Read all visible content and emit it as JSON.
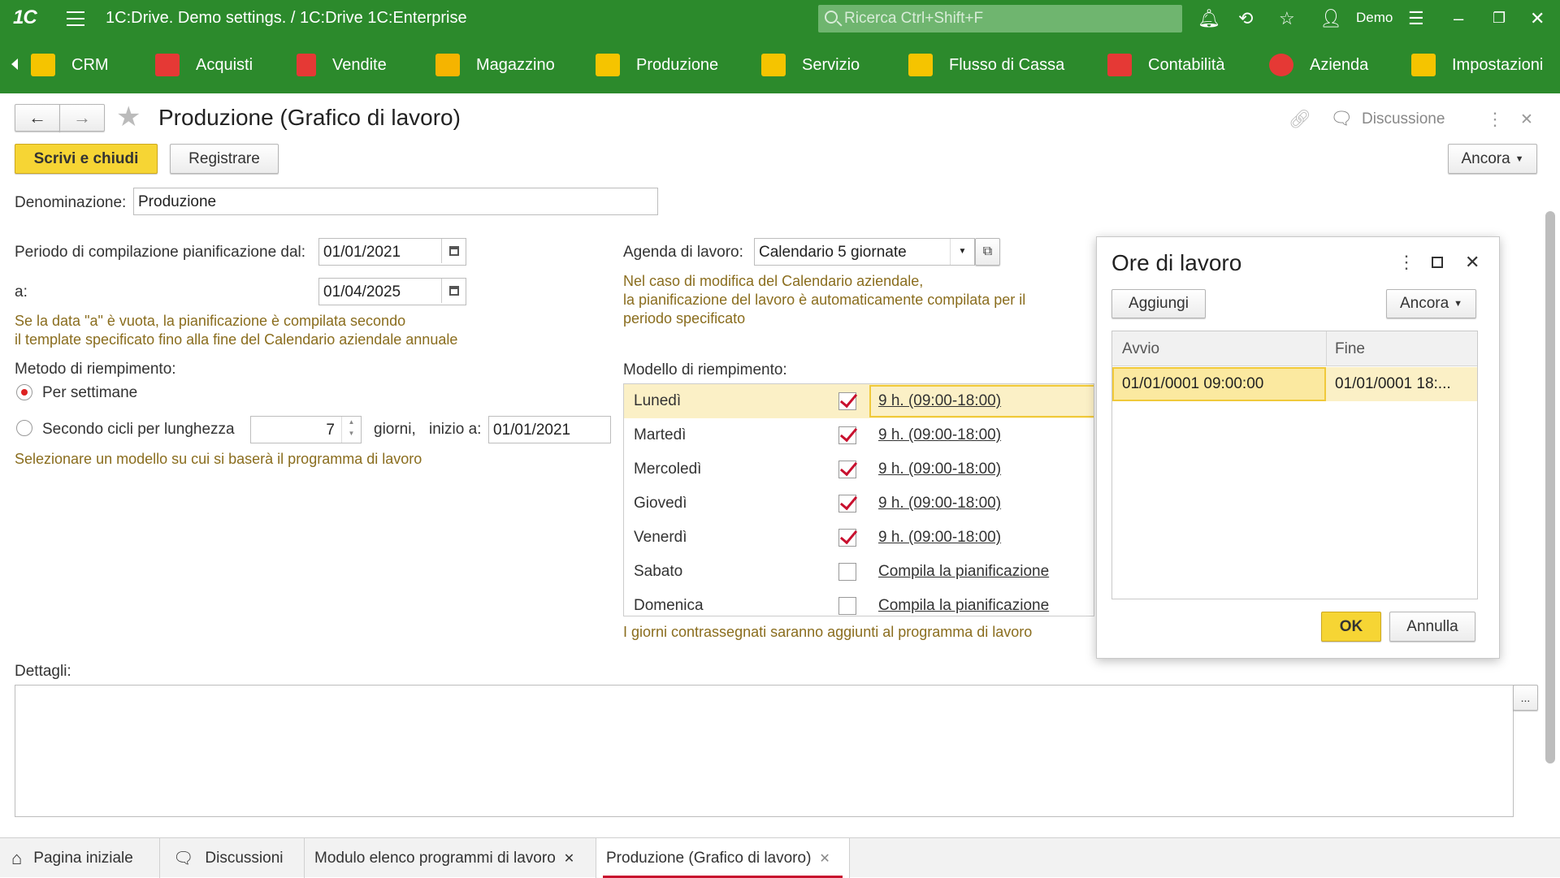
{
  "app": {
    "logo": "1С",
    "title": "1C:Drive. Demo settings. / 1C:Drive 1C:Enterprise",
    "search_placeholder": "Ricerca Ctrl+Shift+F",
    "user": "Demo"
  },
  "nav": {
    "items": [
      {
        "label": "CRM",
        "icon": "crm-icon",
        "color": "#f5c400"
      },
      {
        "label": "Acquisti",
        "icon": "truck-icon",
        "color": "#e53935"
      },
      {
        "label": "Vendite",
        "icon": "cart-icon",
        "color": "#e53935"
      },
      {
        "label": "Magazzino",
        "icon": "box-icon",
        "color": "#f5b400"
      },
      {
        "label": "Produzione",
        "icon": "factory-icon",
        "color": "#f5c400"
      },
      {
        "label": "Servizio",
        "icon": "hierarchy-icon",
        "color": "#f5c400"
      },
      {
        "label": "Flusso di Cassa",
        "icon": "cash-icon",
        "color": "#f5c400"
      },
      {
        "label": "Contabilità",
        "icon": "ledger-icon",
        "color": "#e53935"
      },
      {
        "label": "Azienda",
        "icon": "azienda-icon",
        "color": "#e53935"
      },
      {
        "label": "Impostazioni",
        "icon": "settings-grid-icon",
        "color": "#f5c400"
      }
    ]
  },
  "form": {
    "title": "Produzione (Grafico di lavoro)",
    "discussion": "Discussione",
    "write_close": "Scrivi e chiudi",
    "register": "Registrare",
    "more": "Ancora",
    "name_label": "Denominazione:",
    "name_value": "Produzione",
    "period_from_label": "Periodo di compilazione pianificazione dal:",
    "period_from_value": "01/01/2021",
    "period_to_label": "a:",
    "period_to_value": "01/04/2025",
    "period_hint_1": "Se la data \"a\" è vuota, la pianificazione è compilata secondo",
    "period_hint_2": "il template specificato fino alla fine del Calendario aziendale annuale",
    "method_label": "Metodo di riempimento:",
    "method_weeks": "Per  settimane",
    "method_cycles": "Secondo cicli per lunghezza",
    "cycle_length": "7",
    "days_label": "giorni,",
    "start_label": "inizio a:",
    "start_value": "01/01/2021",
    "method_hint": "Selezionare un modello su cui si baserà il programma di lavoro",
    "agenda_label": "Agenda di lavoro:",
    "agenda_value": "Calendario 5 giornate",
    "agenda_hint_1": "Nel caso di modifica del Calendario aziendale,",
    "agenda_hint_2": "la pianificazione del lavoro è automaticamente compilata per il",
    "agenda_hint_3": "periodo specificato",
    "model_label": "Modello di riempimento:",
    "model_hint": "I giorni contrassegnati saranno aggiunti al programma di lavoro",
    "details_label": "Dettagli:",
    "details_button": "..."
  },
  "days": [
    {
      "day": "Lunedì",
      "checked": true,
      "link": "9 h. (09:00-18:00)"
    },
    {
      "day": "Martedì",
      "checked": true,
      "link": "9 h. (09:00-18:00)"
    },
    {
      "day": "Mercoledì",
      "checked": true,
      "link": "9 h. (09:00-18:00)"
    },
    {
      "day": "Giovedì",
      "checked": true,
      "link": "9 h. (09:00-18:00)"
    },
    {
      "day": "Venerdì",
      "checked": true,
      "link": "9 h. (09:00-18:00)"
    },
    {
      "day": "Sabato",
      "checked": false,
      "link": "Compila la pianificazione"
    },
    {
      "day": "Domenica",
      "checked": false,
      "link": "Compila la pianificazione"
    }
  ],
  "dialog": {
    "title": "Ore di lavoro",
    "add": "Aggiungi",
    "more": "Ancora",
    "col_start": "Avvio",
    "col_end": "Fine",
    "row_start": "01/01/0001 09:00:00",
    "row_end": "01/01/0001 18:...",
    "ok": "OK",
    "cancel": "Annulla"
  },
  "tabs": [
    {
      "label": "Pagina iniziale",
      "icon": "home-icon"
    },
    {
      "label": "Discussioni",
      "icon": "chat-icon"
    },
    {
      "label": "Modulo elenco programmi di lavoro",
      "icon": ""
    },
    {
      "label": "Produzione (Grafico di lavoro)",
      "icon": ""
    }
  ],
  "colors": {
    "green": "#2c8a2c",
    "yellow": "#f6d534",
    "hint": "#8a6d1e",
    "accent": "#c8102e"
  }
}
